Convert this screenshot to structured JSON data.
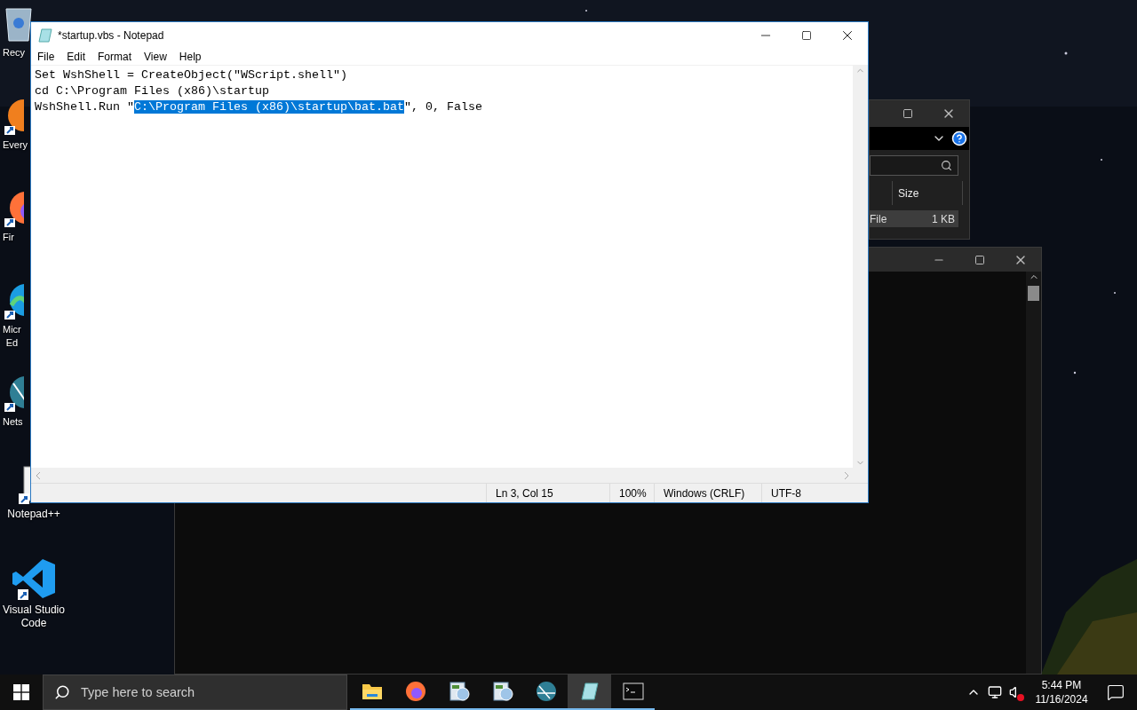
{
  "desktop": {
    "icons": [
      {
        "label": [
          "Recy"
        ],
        "kind": "trash"
      },
      {
        "label": [
          "Every"
        ],
        "kind": "search"
      },
      {
        "label": [
          "Fir"
        ],
        "kind": "fox"
      },
      {
        "label": [
          "Micr",
          "Ed"
        ],
        "kind": "wave"
      },
      {
        "label": [
          "Nets"
        ],
        "kind": "globe"
      },
      {
        "label": [
          "Notepad++"
        ],
        "kind": "notepadpp"
      },
      {
        "label": [
          "Visual Studio",
          "Code"
        ],
        "kind": "code"
      }
    ]
  },
  "explorer": {
    "columns": [
      "Size"
    ],
    "rows": [
      {
        "cells": [
          "File",
          "1 KB"
        ],
        "selected": true
      }
    ]
  },
  "notepad": {
    "title": "*startup.vbs - Notepad",
    "menu": [
      "File",
      "Edit",
      "Format",
      "View",
      "Help"
    ],
    "lines": [
      [
        {
          "text": "Set WshShell = CreateObject(\"WScript.shell\")",
          "selected": false
        }
      ],
      [
        {
          "text": "cd C:\\Program Files (x86)\\startup",
          "selected": false
        }
      ],
      [
        {
          "text": "WshShell.Run \"",
          "selected": false
        },
        {
          "text": "C:\\Program Files (x86)\\startup\\bat.bat",
          "selected": true
        },
        {
          "text": "\", 0, False",
          "selected": false
        }
      ]
    ],
    "status": [
      "Ln 3, Col 15",
      "100%",
      "Windows (CRLF)",
      "UTF-8"
    ]
  },
  "taskbar": {
    "search_placeholder": "Type here to search",
    "apps": [
      {
        "kind": "folder",
        "selected": false
      },
      {
        "kind": "fox",
        "selected": false
      },
      {
        "kind": "app",
        "selected": false
      },
      {
        "kind": "app",
        "selected": false
      },
      {
        "kind": "globe",
        "selected": false
      },
      {
        "kind": "notepad",
        "selected": true
      },
      {
        "kind": "terminal",
        "selected": false
      }
    ],
    "volume_muted": true,
    "time": "5:44 PM",
    "date": "11/16/2024"
  }
}
